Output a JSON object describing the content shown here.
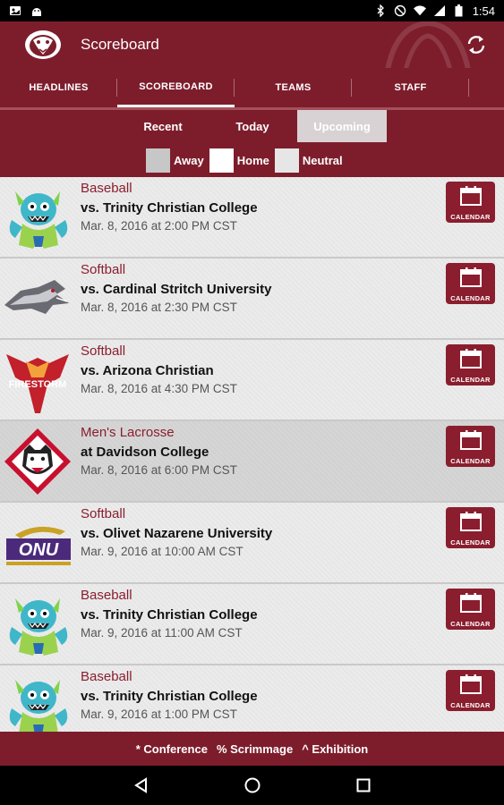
{
  "status_bar": {
    "time": "1:54",
    "left_icons": [
      "photo-notification-icon",
      "android-notification-icon"
    ],
    "right_icons": [
      "bluetooth-icon",
      "mute-icon",
      "wifi-icon",
      "signal-icon",
      "battery-icon"
    ]
  },
  "app_bar": {
    "title": "Scoreboard",
    "logo_icon": "panther-logo-icon",
    "action_icon": "refresh-icon"
  },
  "tabs": [
    {
      "label": "HEADLINES",
      "active": false
    },
    {
      "label": "SCOREBOARD",
      "active": true
    },
    {
      "label": "TEAMS",
      "active": false
    },
    {
      "label": "STAFF",
      "active": false
    }
  ],
  "segments": [
    {
      "label": "Recent",
      "active": false
    },
    {
      "label": "Today",
      "active": false
    },
    {
      "label": "Upcoming",
      "active": true
    }
  ],
  "legend": [
    {
      "label": "Away",
      "color": "#c7c7c7"
    },
    {
      "label": "Home",
      "color": "#ffffff"
    },
    {
      "label": "Neutral",
      "color": "#e6e6e6"
    }
  ],
  "games": [
    {
      "sport": "Baseball",
      "opponent": "vs. Trinity Christian College",
      "datetime": "Mar. 8, 2016 at 2:00 PM CST",
      "logo": "trinity-troll-logo",
      "button": "CALENDAR",
      "highlight": false
    },
    {
      "sport": "Softball",
      "opponent": "vs. Cardinal Stritch University",
      "datetime": "Mar. 8, 2016 at 2:30 PM CST",
      "logo": "wolf-logo",
      "button": "CALENDAR",
      "highlight": false
    },
    {
      "sport": "Softball",
      "opponent": "vs. Arizona Christian",
      "datetime": "Mar. 8, 2016 at 4:30 PM CST",
      "logo": "firestorm-logo",
      "logo_text": "FIRESTORM",
      "button": "CALENDAR",
      "highlight": false
    },
    {
      "sport": "Men's Lacrosse",
      "opponent": "at Davidson College",
      "datetime": "Mar. 8, 2016 at 6:00 PM CST",
      "logo": "wildcat-logo",
      "button": "CALENDAR",
      "highlight": true
    },
    {
      "sport": "Softball",
      "opponent": "vs. Olivet Nazarene University",
      "datetime": "Mar. 9, 2016 at 10:00 AM CST",
      "logo": "onu-logo",
      "logo_text": "ONU",
      "button": "CALENDAR",
      "highlight": false
    },
    {
      "sport": "Baseball",
      "opponent": "vs. Trinity Christian College",
      "datetime": "Mar. 9, 2016 at 11:00 AM CST",
      "logo": "trinity-troll-logo",
      "button": "CALENDAR",
      "highlight": false
    },
    {
      "sport": "Baseball",
      "opponent": "vs. Trinity Christian College",
      "datetime": "Mar. 9, 2016 at 1:00 PM CST",
      "logo": "trinity-troll-logo",
      "button": "CALENDAR",
      "highlight": false
    }
  ],
  "footer_legend": [
    "* Conference",
    "% Scrimmage",
    "^ Exhibition"
  ],
  "nav_bar": [
    "back-icon",
    "home-icon",
    "recents-icon"
  ],
  "colors": {
    "primary": "#7d1d2c",
    "accent": "#8a1e2e"
  }
}
